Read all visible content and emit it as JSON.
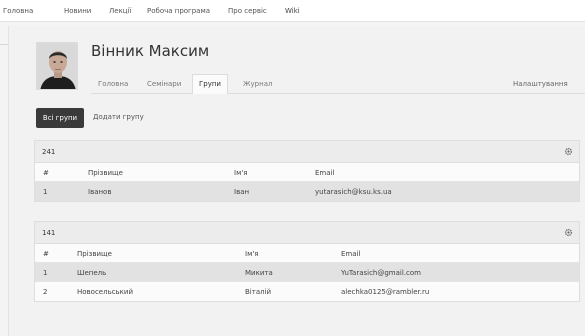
{
  "topnav": {
    "items": [
      "Головна",
      "Новини",
      "Лекції",
      "Робоча програма",
      "Про сервіс",
      "Wiki"
    ]
  },
  "profile": {
    "name": "Вінник Максим"
  },
  "tabs": [
    {
      "label": "Головна",
      "active": false
    },
    {
      "label": "Семінари",
      "active": false
    },
    {
      "label": "Групи",
      "active": true
    },
    {
      "label": "Журнал",
      "active": false
    }
  ],
  "settings_label": "Налаштування",
  "actions": {
    "all_groups": "Всі групи",
    "add_group": "Додати групу"
  },
  "groups": [
    {
      "title": "241",
      "columns": [
        "#",
        "Прізвище",
        "Ім'я",
        "Email"
      ],
      "rows": [
        [
          "1",
          "Іванов",
          "Іван",
          "yutarasich@ksu.ks.ua"
        ]
      ]
    },
    {
      "title": "141",
      "columns": [
        "#",
        "Прізвище",
        "Ім'я",
        "Email"
      ],
      "rows": [
        [
          "1",
          "Шепель",
          "Микита",
          "YuTarasich@gmail.com"
        ],
        [
          "2",
          "Новосельський",
          "Віталій",
          "alechka0125@rambler.ru"
        ]
      ]
    }
  ]
}
